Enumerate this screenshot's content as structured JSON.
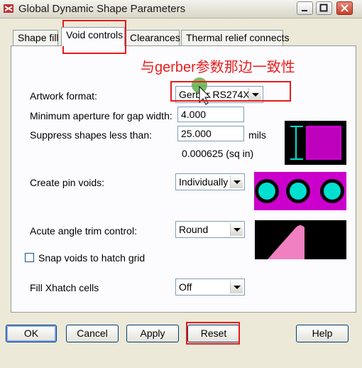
{
  "window": {
    "title": "Global Dynamic Shape Parameters"
  },
  "tabs": [
    {
      "label": "Shape fill"
    },
    {
      "label": "Void controls",
      "active": true
    },
    {
      "label": "Clearances"
    },
    {
      "label": "Thermal relief connects"
    }
  ],
  "annotation": {
    "text": "与gerber参数那边一致性"
  },
  "form": {
    "artwork_format": {
      "label": "Artwork format:",
      "value": "Gerber RS274X"
    },
    "min_aperture": {
      "label": "Minimum aperture for gap width:",
      "value": "4.000"
    },
    "suppress_shapes": {
      "label": "Suppress shapes less than:",
      "value": "25.000",
      "unit": "mils",
      "area": "0.000625 (sq in)"
    },
    "pin_voids": {
      "label": "Create pin voids:",
      "value": "Individually"
    },
    "acute_angle": {
      "label": "Acute angle trim control:",
      "value": "Round"
    },
    "snap_voids": {
      "label": "Snap voids to hatch grid",
      "checked": false
    },
    "fill_xhatch": {
      "label": "Fill Xhatch cells",
      "value": "Off"
    }
  },
  "buttons": {
    "ok": "OK",
    "cancel": "Cancel",
    "apply": "Apply",
    "reset": "Reset",
    "help": "Help"
  },
  "colors": {
    "preview_bg": "#000000",
    "magenta": "#cc00cc",
    "cyan": "#00e0d0",
    "pink": "#f080c0",
    "annotation_red": "#e81c1c"
  }
}
